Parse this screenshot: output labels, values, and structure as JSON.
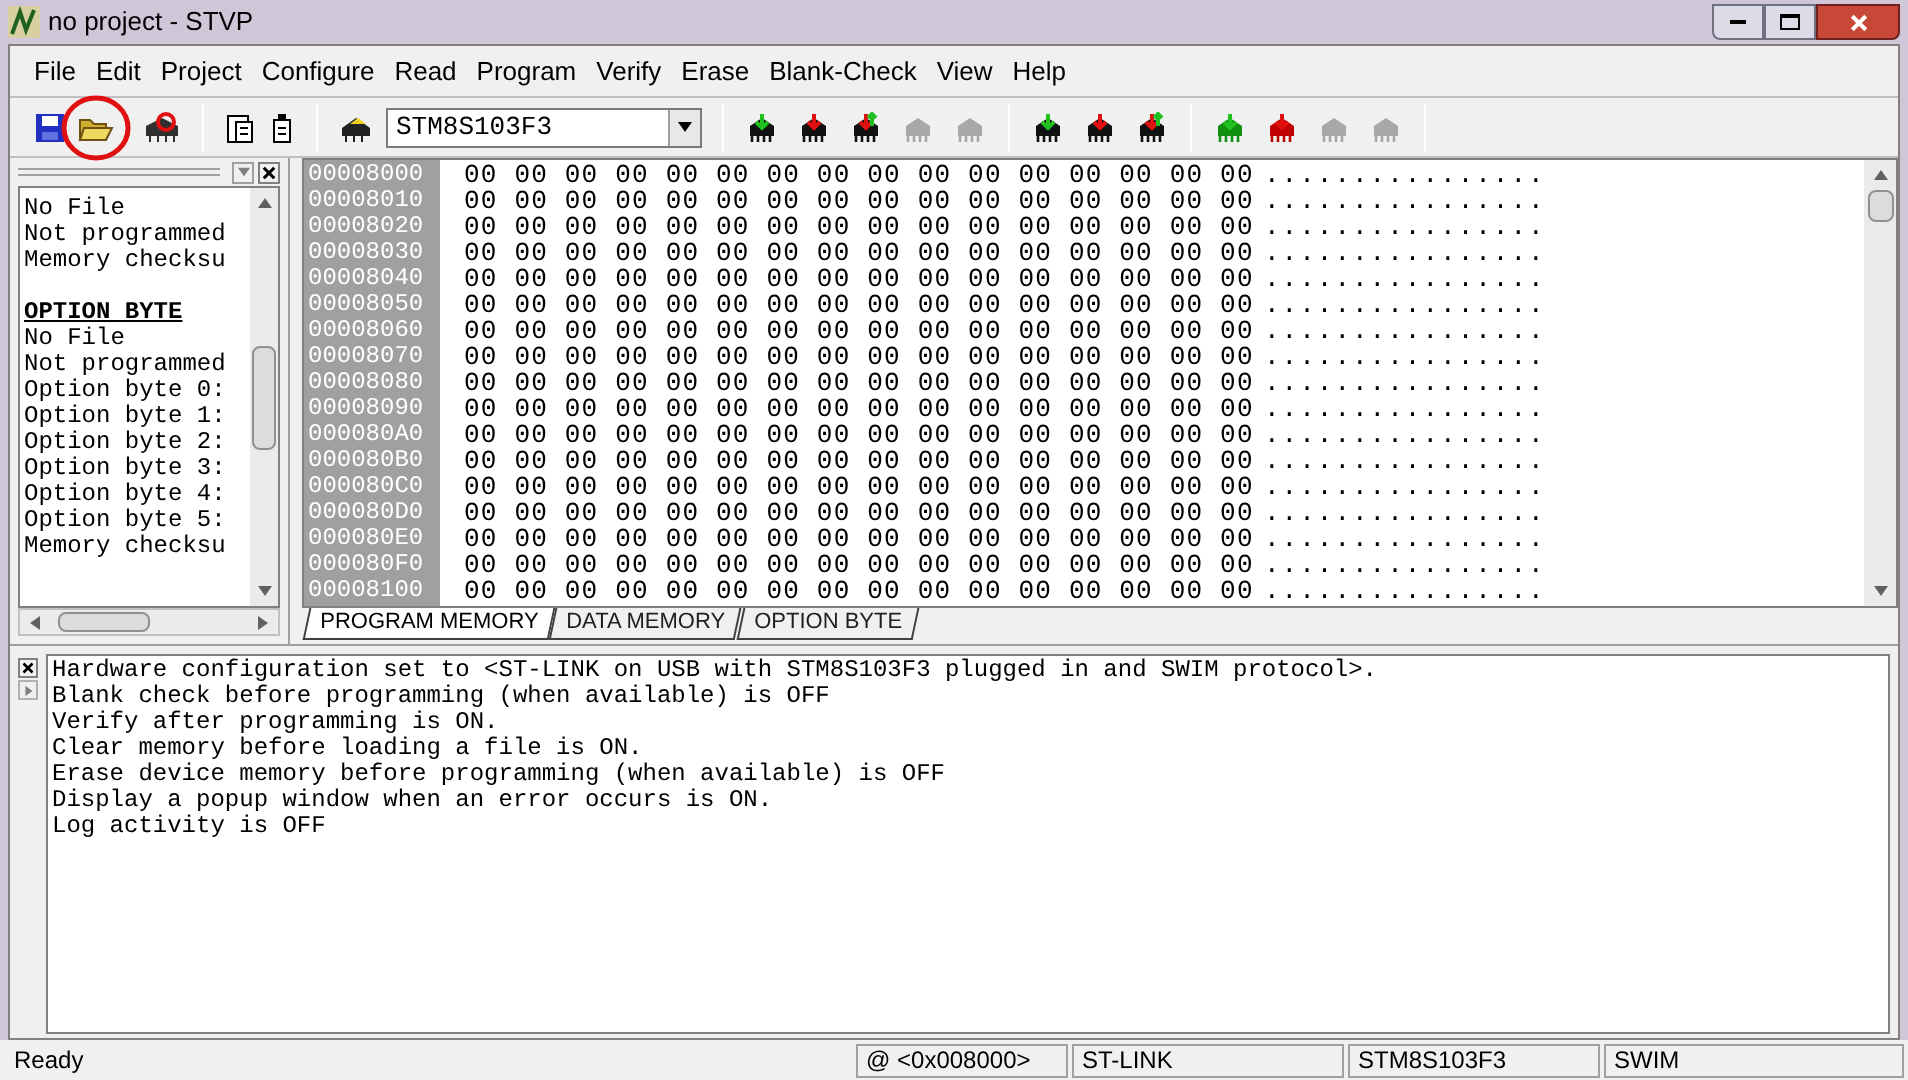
{
  "window": {
    "title": "no project - STVP"
  },
  "menu": [
    "File",
    "Edit",
    "Project",
    "Configure",
    "Read",
    "Program",
    "Verify",
    "Erase",
    "Blank-Check",
    "View",
    "Help"
  ],
  "toolbar": {
    "device": "STM8S103F3",
    "groups": [
      {
        "buttons": [
          {
            "kind": "read",
            "disabled": false
          },
          {
            "kind": "program",
            "disabled": false
          },
          {
            "kind": "verify",
            "disabled": false
          },
          {
            "kind": "erase",
            "disabled": true
          },
          {
            "kind": "blank",
            "disabled": true
          }
        ]
      },
      {
        "buttons": [
          {
            "kind": "read",
            "disabled": false
          },
          {
            "kind": "program",
            "disabled": false
          },
          {
            "kind": "verify",
            "disabled": false
          }
        ]
      },
      {
        "buttons": [
          {
            "kind": "read",
            "disabled": false
          },
          {
            "kind": "program",
            "disabled": false
          },
          {
            "kind": "verify",
            "disabled": true
          },
          {
            "kind": "blank",
            "disabled": true
          }
        ]
      }
    ]
  },
  "info_panel": {
    "lines": [
      {
        "kind": "text",
        "text": "No File"
      },
      {
        "kind": "text",
        "text": "Not programmed"
      },
      {
        "kind": "text",
        "text": "Memory checksu"
      },
      {
        "kind": "blank"
      },
      {
        "kind": "heading",
        "text": "OPTION BYTE"
      },
      {
        "kind": "text",
        "text": "No File"
      },
      {
        "kind": "text",
        "text": "Not programmed"
      },
      {
        "kind": "text",
        "text": "Option byte 0:"
      },
      {
        "kind": "text",
        "text": "Option byte 1:"
      },
      {
        "kind": "text",
        "text": "Option byte 2:"
      },
      {
        "kind": "text",
        "text": "Option byte 3:"
      },
      {
        "kind": "text",
        "text": "Option byte 4:"
      },
      {
        "kind": "text",
        "text": "Option byte 5:"
      },
      {
        "kind": "text",
        "text": "Memory checksu"
      }
    ]
  },
  "memory": {
    "rows": [
      {
        "address": "00008000",
        "bytes": "00 00 00 00 00 00 00 00 00 00 00 00 00 00 00 00",
        "ascii": "................"
      },
      {
        "address": "00008010",
        "bytes": "00 00 00 00 00 00 00 00 00 00 00 00 00 00 00 00",
        "ascii": "................"
      },
      {
        "address": "00008020",
        "bytes": "00 00 00 00 00 00 00 00 00 00 00 00 00 00 00 00",
        "ascii": "................"
      },
      {
        "address": "00008030",
        "bytes": "00 00 00 00 00 00 00 00 00 00 00 00 00 00 00 00",
        "ascii": "................"
      },
      {
        "address": "00008040",
        "bytes": "00 00 00 00 00 00 00 00 00 00 00 00 00 00 00 00",
        "ascii": "................"
      },
      {
        "address": "00008050",
        "bytes": "00 00 00 00 00 00 00 00 00 00 00 00 00 00 00 00",
        "ascii": "................"
      },
      {
        "address": "00008060",
        "bytes": "00 00 00 00 00 00 00 00 00 00 00 00 00 00 00 00",
        "ascii": "................"
      },
      {
        "address": "00008070",
        "bytes": "00 00 00 00 00 00 00 00 00 00 00 00 00 00 00 00",
        "ascii": "................"
      },
      {
        "address": "00008080",
        "bytes": "00 00 00 00 00 00 00 00 00 00 00 00 00 00 00 00",
        "ascii": "................"
      },
      {
        "address": "00008090",
        "bytes": "00 00 00 00 00 00 00 00 00 00 00 00 00 00 00 00",
        "ascii": "................"
      },
      {
        "address": "000080A0",
        "bytes": "00 00 00 00 00 00 00 00 00 00 00 00 00 00 00 00",
        "ascii": "................"
      },
      {
        "address": "000080B0",
        "bytes": "00 00 00 00 00 00 00 00 00 00 00 00 00 00 00 00",
        "ascii": "................"
      },
      {
        "address": "000080C0",
        "bytes": "00 00 00 00 00 00 00 00 00 00 00 00 00 00 00 00",
        "ascii": "................"
      },
      {
        "address": "000080D0",
        "bytes": "00 00 00 00 00 00 00 00 00 00 00 00 00 00 00 00",
        "ascii": "................"
      },
      {
        "address": "000080E0",
        "bytes": "00 00 00 00 00 00 00 00 00 00 00 00 00 00 00 00",
        "ascii": "................"
      },
      {
        "address": "000080F0",
        "bytes": "00 00 00 00 00 00 00 00 00 00 00 00 00 00 00 00",
        "ascii": "................"
      },
      {
        "address": "00008100",
        "bytes": "00 00 00 00 00 00 00 00 00 00 00 00 00 00 00 00",
        "ascii": "................"
      }
    ]
  },
  "tabs": [
    {
      "label": "PROGRAM MEMORY",
      "selected": true
    },
    {
      "label": "DATA MEMORY",
      "selected": false
    },
    {
      "label": "OPTION BYTE",
      "selected": false
    }
  ],
  "log": [
    "Hardware configuration set to <ST-LINK on USB with STM8S103F3 plugged in and SWIM protocol>.",
    "Blank check before programming (when available) is OFF",
    "Verify after programming is ON.",
    "Clear memory before loading a file is ON.",
    "Erase device memory before programming (when available) is OFF",
    "Display a popup window when an error occurs is ON.",
    "Log activity is OFF"
  ],
  "status_bar": [
    "Ready",
    "@ <0x008000>",
    "ST-LINK",
    "STM8S103F3",
    "SWIM"
  ]
}
